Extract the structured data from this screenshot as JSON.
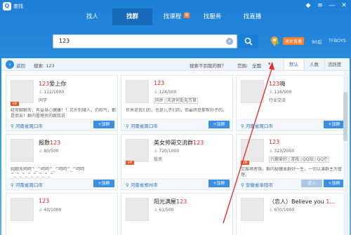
{
  "window": {
    "title": "查找",
    "logo": "Q"
  },
  "window_controls": {
    "skin_icon": "◆",
    "menu_icon": "≡",
    "min": "—",
    "close": "✕"
  },
  "tabs": [
    {
      "label": "找人"
    },
    {
      "label": "找群"
    },
    {
      "label": "找课程",
      "badge": "新"
    },
    {
      "label": "找服务"
    },
    {
      "label": "找直播"
    }
  ],
  "search": {
    "value": "123",
    "clear_icon": "×"
  },
  "header_right": {
    "region_badge": "美女直播",
    "hot1": "90后",
    "hot2": "TFBOYS"
  },
  "filter": {
    "back_label": "返回",
    "search_label": "搜索: 123",
    "not_found": "搜索不到我的群？",
    "range_label": "范围:",
    "range_value": "全国",
    "sort_options": [
      "默认",
      "人数",
      "活跃度"
    ]
  },
  "cards": [
    {
      "name_prefix": "",
      "name_hl": "123",
      "name_suffix": "爱上你",
      "members": "112/1000",
      "tags": [
        {
          "text": "同学",
          "chip": false
        }
      ],
      "vip": "VIP",
      "desc": "经常聊聊天，有益身心健康！！另外别矮人，仍和气，都是朋友！群内管理员的跟我说",
      "location": "河南省周口市",
      "join": "+加群"
    },
    {
      "name_prefix": "",
      "name_hl": "123",
      "name_suffix": "",
      "members": "124/500",
      "tags": [
        {
          "text": "同乡",
          "chip": true
        },
        {
          "text": "天涯何处无芳草",
          "chip": true
        }
      ],
      "vip": "",
      "desc": "世界是我们的，也是儿子们的，但最终是那帮孙子的。",
      "location": "河南省周口市",
      "join": "+加群"
    },
    {
      "name_prefix": "",
      "name_hl": "123",
      "name_suffix": "嗨",
      "members": "116/500",
      "tags": [
        {
          "text": "行业交流",
          "chip": false
        }
      ],
      "vip": "",
      "desc": "",
      "location": "河南省周口市",
      "join": "+加群"
    },
    {
      "name_prefix": "报数",
      "name_hl": "123",
      "name_suffix": "",
      "members": "80/500",
      "tags": [],
      "vip": "",
      "desc": "纯聊天呵呵^_^呵呵^_^呵呵^_^呵呵^_^_^_^_^_^_^_^",
      "location": "河南省周口市",
      "join": "+加群"
    },
    {
      "name_prefix": "美女帅哥交流群",
      "name_hl": "123",
      "name_suffix": "",
      "members": "720/1000",
      "tags": [
        {
          "text": "投资",
          "chip": false
        }
      ],
      "vip": "VIP",
      "desc": "",
      "location": "河南省郑州市",
      "join": "+加群"
    },
    {
      "name_prefix": "",
      "name_hl": "123",
      "name_suffix": "",
      "members": "323/2000",
      "tags": [
        {
          "text": "兴趣爱好",
          "chip": true
        },
        {
          "text": "游戏",
          "chip": true
        },
        {
          "text": "QQ钻",
          "chip": true
        },
        {
          "text": "QQ空",
          "chip": true
        }
      ],
      "vip": "VIP",
      "desc": "交易萌者强，群内秘孃本群好一生，一切以演群主为管理。",
      "location": "安徽省阜阳市",
      "join": "+加群",
      "enter": "进入"
    },
    {
      "name_prefix": "",
      "name_hl": "123",
      "name_suffix": "",
      "members": "40/1000",
      "tags": [],
      "vip": "",
      "desc": "",
      "location": "",
      "join": ""
    },
    {
      "name_prefix": "阳光满屋",
      "name_hl": "123",
      "name_suffix": "",
      "members": "61/500",
      "tags": [],
      "vip": "",
      "desc": "",
      "location": "",
      "join": ""
    },
    {
      "name_prefix": "（恋人）Believe you ",
      "name_hl": "1...",
      "name_suffix": "",
      "members": "670/1000",
      "tags": [],
      "vip": "",
      "desc": "",
      "location": "",
      "join": ""
    }
  ],
  "colors": {
    "accent": "#2b8de0",
    "highlight": "#e2231a",
    "arrow": "#e8302a"
  }
}
